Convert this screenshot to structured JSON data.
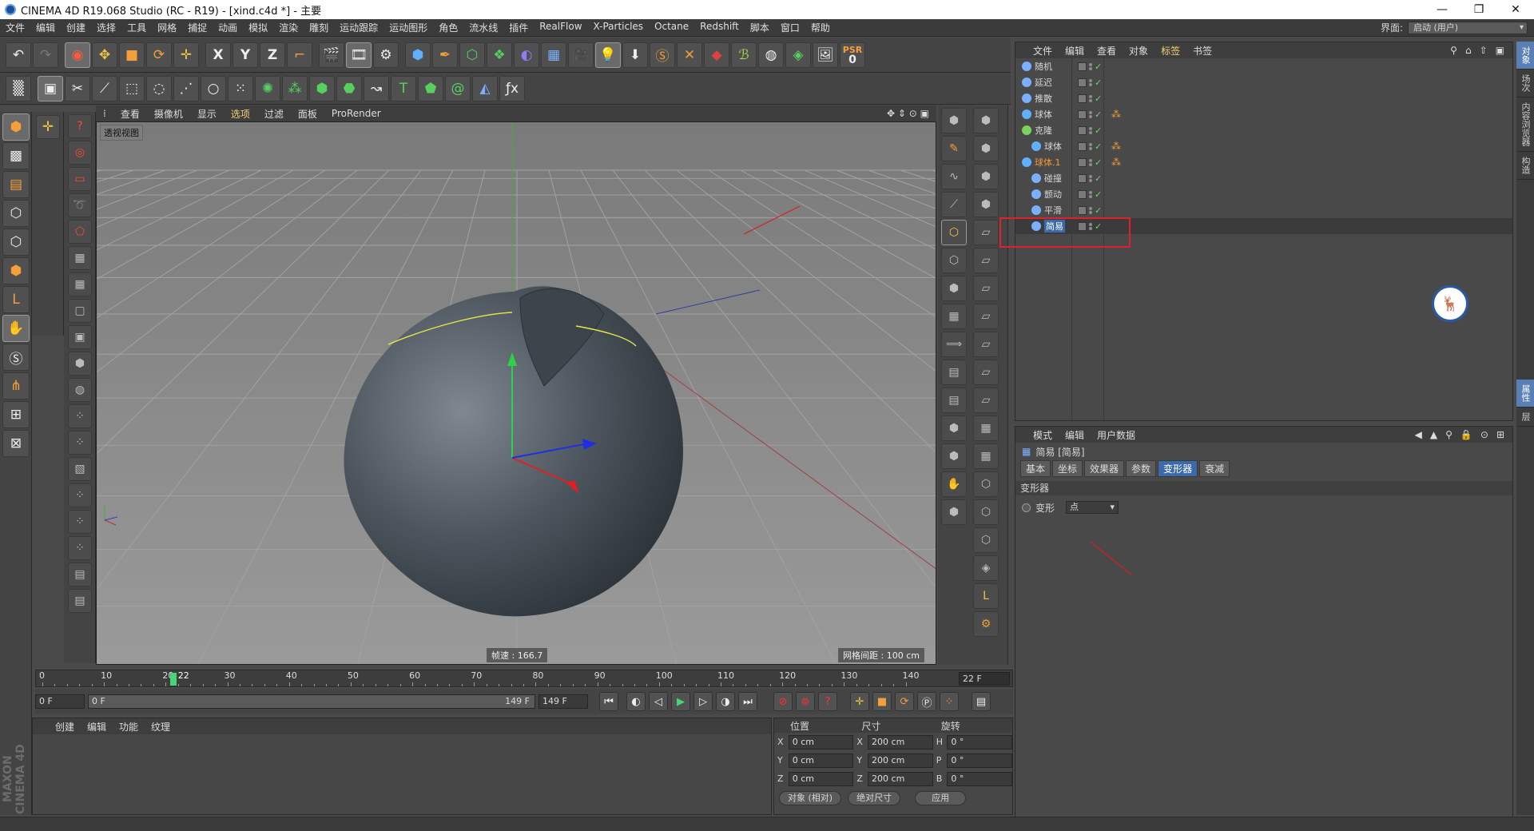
{
  "window": {
    "title": "CINEMA 4D R19.068 Studio (RC - R19) - [xind.c4d *] - 主要",
    "controls": [
      "—",
      "❐",
      "✕"
    ]
  },
  "menubar": {
    "items": [
      "文件",
      "编辑",
      "创建",
      "选择",
      "工具",
      "网格",
      "捕捉",
      "动画",
      "模拟",
      "渲染",
      "雕刻",
      "运动跟踪",
      "运动图形",
      "角色",
      "流水线",
      "插件",
      "RealFlow",
      "X-Particles",
      "Octane",
      "Redshift",
      "脚本",
      "窗口",
      "帮助"
    ],
    "layout_label": "界面:",
    "layout_value": "启动 (用户)"
  },
  "toolbar": {
    "psr_label": "PSR",
    "psr_value": "0",
    "x": "X",
    "y": "Y",
    "z": "Z"
  },
  "viewport": {
    "menu": [
      "查看",
      "摄像机",
      "显示",
      "选项",
      "过滤",
      "面板",
      "ProRender"
    ],
    "active_menu_index": 3,
    "camera_label": "透视视图",
    "fps_text": "帧速 : 166.7",
    "grid_text": "网格间距 : 100 cm"
  },
  "object_manager": {
    "menu": [
      "文件",
      "编辑",
      "查看",
      "对象",
      "标签",
      "书签"
    ],
    "active_menu_index": 4,
    "objects": [
      {
        "name": "随机",
        "indent": 0,
        "icon_color": "#7ab0ff",
        "tag": false
      },
      {
        "name": "延迟",
        "indent": 0,
        "icon_color": "#7ab0ff",
        "tag": false
      },
      {
        "name": "推散",
        "indent": 0,
        "icon_color": "#7ab0ff",
        "tag": false
      },
      {
        "name": "球体",
        "indent": 0,
        "icon_color": "#5fb0ff",
        "tag": true
      },
      {
        "name": "克隆",
        "indent": 0,
        "icon_color": "#7ad35f",
        "tag": false
      },
      {
        "name": "球体",
        "indent": 1,
        "icon_color": "#5fb0ff",
        "tag": true
      },
      {
        "name": "球体.1",
        "indent": 0,
        "icon_color": "#5fb0ff",
        "tag": true,
        "highlight": true
      },
      {
        "name": "碰撞",
        "indent": 1,
        "icon_color": "#7ab0ff",
        "tag": false
      },
      {
        "name": "颤动",
        "indent": 1,
        "icon_color": "#7ab0ff",
        "tag": false
      },
      {
        "name": "平滑",
        "indent": 1,
        "icon_color": "#7ab0ff",
        "tag": false
      },
      {
        "name": "简易",
        "indent": 1,
        "icon_color": "#7ab0ff",
        "tag": false,
        "selected": true
      }
    ]
  },
  "attributes": {
    "menu": [
      "模式",
      "编辑",
      "用户数据"
    ],
    "object_title": "简易 [简易]",
    "tabs": [
      "基本",
      "坐标",
      "效果器",
      "参数",
      "变形器",
      "衰减"
    ],
    "active_tab_index": 4,
    "section": "变形器",
    "prop_label": "变形",
    "prop_value": "点"
  },
  "side_tabs": [
    "对象",
    "场次",
    "内容浏览器",
    "构造",
    "属性",
    "层"
  ],
  "timeline": {
    "ticks": [
      "0",
      "10",
      "20",
      "30",
      "40",
      "50",
      "60",
      "70",
      "80",
      "90",
      "100",
      "110",
      "120",
      "130",
      "140"
    ],
    "current_frame_label": "22",
    "current_frame_value": 22,
    "end_frame": "22 F",
    "max_frames": 149
  },
  "transport": {
    "start": "0 F",
    "range_start": "0 F",
    "range_end": "149 F",
    "end": "149 F"
  },
  "material_manager": {
    "menu": [
      "创建",
      "编辑",
      "功能",
      "纹理"
    ],
    "brand": "MAXON CINEMA 4D"
  },
  "coordinates": {
    "headers": [
      "位置",
      "尺寸",
      "旋转"
    ],
    "rows": [
      {
        "a": "X",
        "pos": "0 cm",
        "b": "X",
        "size": "200 cm",
        "c": "H",
        "rot": "0 °"
      },
      {
        "a": "Y",
        "pos": "0 cm",
        "b": "Y",
        "size": "200 cm",
        "c": "P",
        "rot": "0 °"
      },
      {
        "a": "Z",
        "pos": "0 cm",
        "b": "Z",
        "size": "200 cm",
        "c": "B",
        "rot": "0 °"
      }
    ],
    "mode1": "对象 (相对)",
    "mode2": "绝对尺寸",
    "apply": "应用"
  },
  "colors": {
    "accent": "#f5d27a",
    "selection_box": "#e0202a",
    "timeline_cursor": "#49d47a",
    "active_tab": "#3c6aa8"
  }
}
